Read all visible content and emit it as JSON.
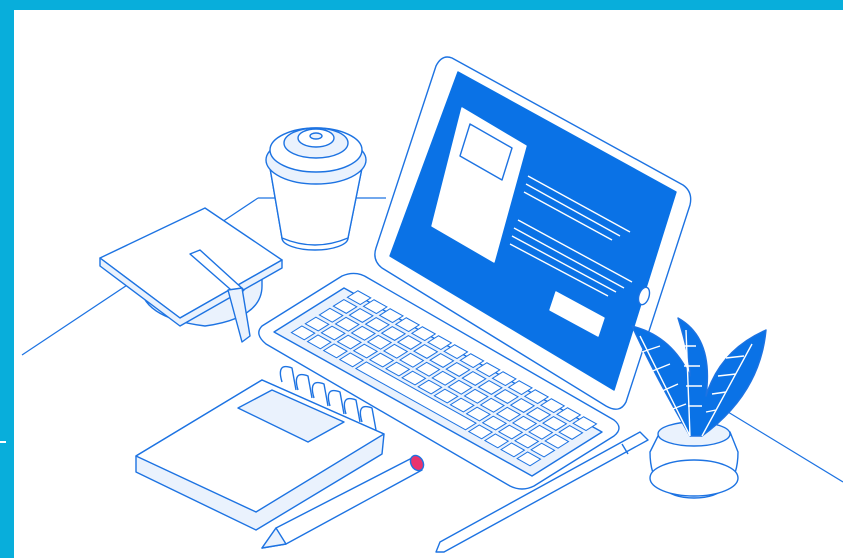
{
  "illustration": {
    "subject": "",
    "colors": {
      "frame": "#08aedb",
      "stroke": "#1d73e2",
      "screen": "#0a72e6",
      "light_fill": "#eaf2fd",
      "white": "#ffffff",
      "pencil_tip": "#e8336d"
    },
    "icons": [
      "tablet-icon",
      "keyboard-icon",
      "coffee-cup-icon",
      "graduation-cap-icon",
      "notebook-icon",
      "pencil-icon",
      "stylus-icon",
      "plant-icon"
    ]
  }
}
